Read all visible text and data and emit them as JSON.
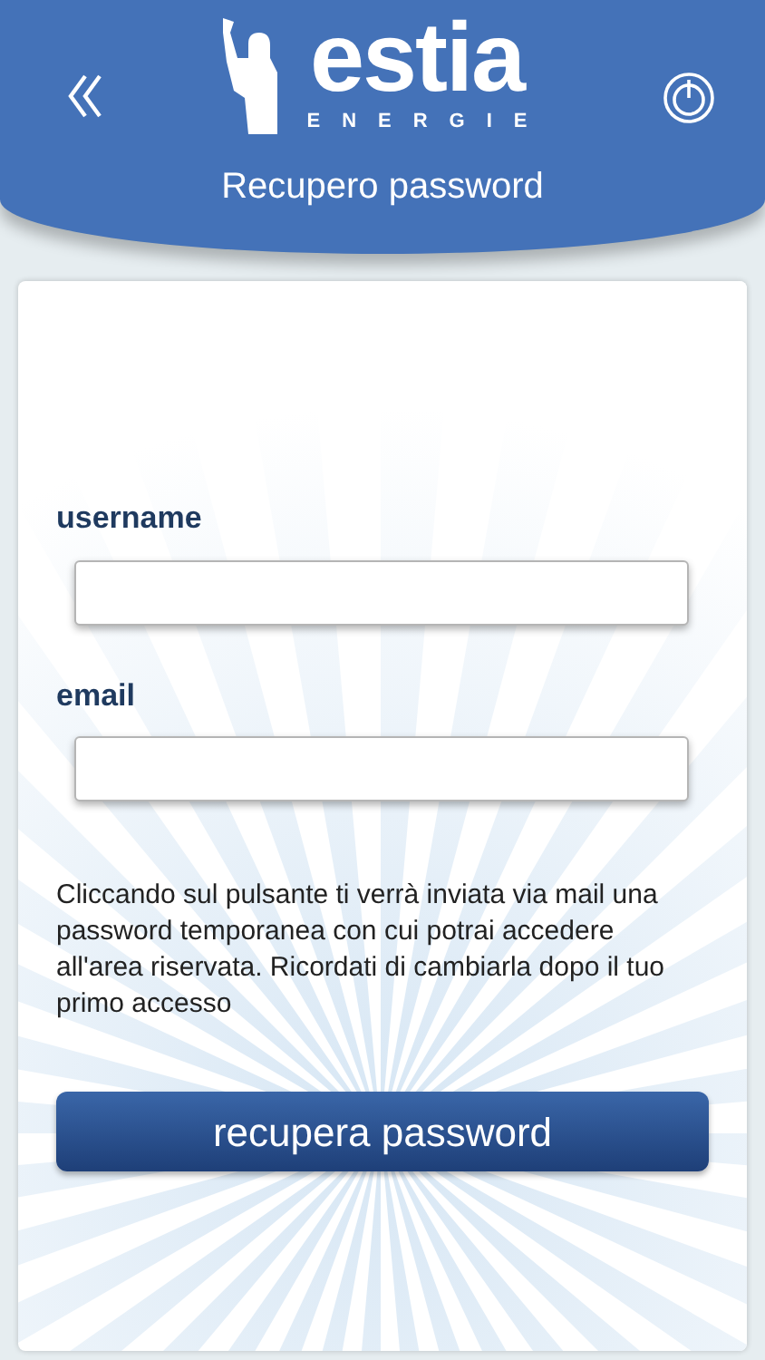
{
  "header": {
    "logo": {
      "name": "estia",
      "tagline": "ENERGIE"
    },
    "title": "Recupero password"
  },
  "form": {
    "fields": [
      {
        "label": "username"
      },
      {
        "label": "email"
      }
    ],
    "info": "Cliccando sul pulsante ti verrà inviata via mail una password temporanea con cui potrai accedere all'area riservata. Ricordati di cambiarla dopo il tuo primo accesso",
    "submit": "recupera password"
  }
}
